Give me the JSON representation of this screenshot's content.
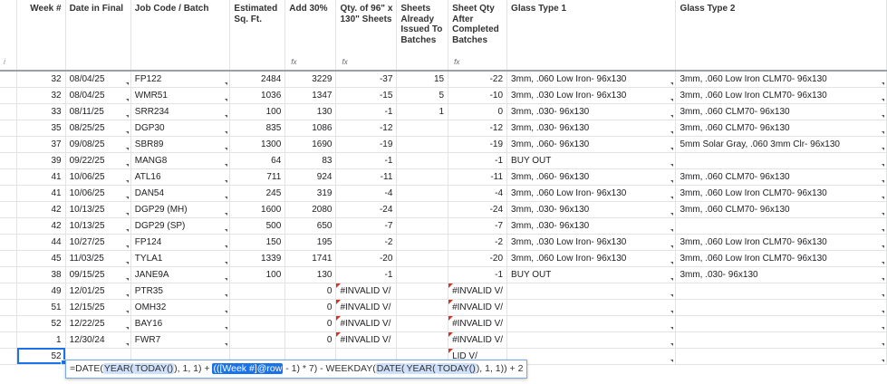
{
  "columns": [
    {
      "label": "",
      "info": "i"
    },
    {
      "label": "Week #"
    },
    {
      "label": "Date in Final"
    },
    {
      "label": "Job Code / Batch"
    },
    {
      "label": "Estimated Sq. Ft."
    },
    {
      "label": "Add 30%",
      "fx": "fx"
    },
    {
      "label": "Qty. of 96\" x 130\" Sheets",
      "fx": "fx"
    },
    {
      "label": "Sheets Already Issued To Batches"
    },
    {
      "label": "Sheet Qty After Completed Batches",
      "fx": "fx"
    },
    {
      "label": "Glass Type 1"
    },
    {
      "label": "Glass Type 2"
    }
  ],
  "rows": [
    {
      "week": "32",
      "date": "08/04/25",
      "job": "FP122",
      "sqft": "2484",
      "add": "3229",
      "qty": "-37",
      "issued": "15",
      "after": "-22",
      "g1": "3mm, .060 Low Iron- 96x130",
      "g2": "3mm, .060 Low Iron CLM70- 96x130"
    },
    {
      "week": "32",
      "date": "08/04/25",
      "job": "WMR51",
      "sqft": "1036",
      "add": "1347",
      "qty": "-15",
      "issued": "5",
      "after": "-10",
      "g1": "3mm, .030 Low Iron- 96x130",
      "g2": "3mm, .060 Low Iron CLM70- 96x130"
    },
    {
      "week": "33",
      "date": "08/11/25",
      "job": "SRR234",
      "sqft": "100",
      "add": "130",
      "qty": "-1",
      "issued": "1",
      "after": "0",
      "g1": "3mm, .030- 96x130",
      "g2": "3mm, .060 CLM70- 96x130"
    },
    {
      "week": "35",
      "date": "08/25/25",
      "job": "DGP30",
      "sqft": "835",
      "add": "1086",
      "qty": "-12",
      "issued": "",
      "after": "-12",
      "g1": "3mm, .030- 96x130",
      "g2": "3mm, .060 CLM70- 96x130"
    },
    {
      "week": "37",
      "date": "09/08/25",
      "job": "SBR89",
      "sqft": "1300",
      "add": "1690",
      "qty": "-19",
      "issued": "",
      "after": "-19",
      "g1": "3mm, .060- 96x130",
      "g2": "5mm Solar Gray, .060 3mm Clr- 96x130"
    },
    {
      "week": "39",
      "date": "09/22/25",
      "job": "MANG8",
      "sqft": "64",
      "add": "83",
      "qty": "-1",
      "issued": "",
      "after": "-1",
      "g1": "BUY OUT",
      "g2": ""
    },
    {
      "week": "41",
      "date": "10/06/25",
      "job": "ATL16",
      "sqft": "711",
      "add": "924",
      "qty": "-11",
      "issued": "",
      "after": "-11",
      "g1": "3mm, .060- 96x130",
      "g2": "3mm, .060 CLM70- 96x130"
    },
    {
      "week": "41",
      "date": "10/06/25",
      "job": "DAN54",
      "sqft": "245",
      "add": "319",
      "qty": "-4",
      "issued": "",
      "after": "-4",
      "g1": "3mm, .060 Low Iron- 96x130",
      "g2": "3mm, .060 Low Iron CLM70- 96x130"
    },
    {
      "week": "42",
      "date": "10/13/25",
      "job": "DGP29 (MH)",
      "sqft": "1600",
      "add": "2080",
      "qty": "-24",
      "issued": "",
      "after": "-24",
      "g1": "3mm, .030- 96x130",
      "g2": "3mm, .060 CLM70- 96x130"
    },
    {
      "week": "42",
      "date": "10/13/25",
      "job": "DGP29 (SP)",
      "sqft": "500",
      "add": "650",
      "qty": "-7",
      "issued": "",
      "after": "-7",
      "g1": "3mm, .030- 96x130",
      "g2": ""
    },
    {
      "week": "44",
      "date": "10/27/25",
      "job": "FP124",
      "sqft": "150",
      "add": "195",
      "qty": "-2",
      "issued": "",
      "after": "-2",
      "g1": "3mm, .030 Low Iron- 96x130",
      "g2": "3mm, .060 Low Iron CLM70- 96x130"
    },
    {
      "week": "45",
      "date": "11/03/25",
      "job": "TYLA1",
      "sqft": "1339",
      "add": "1741",
      "qty": "-20",
      "issued": "",
      "after": "-20",
      "g1": "3mm, .060 Low Iron- 96x130",
      "g2": "3mm, .060 Low Iron CLM70- 96x130"
    },
    {
      "week": "38",
      "date": "09/15/25",
      "job": "JANE9A",
      "sqft": "100",
      "add": "130",
      "qty": "-1",
      "issued": "",
      "after": "-1",
      "g1": "BUY OUT",
      "g2": "3mm, .030- 96x130"
    },
    {
      "week": "49",
      "date": "12/01/25",
      "job": "PTR35",
      "sqft": "",
      "add": "0",
      "qty": "#INVALID V/",
      "issued": "",
      "after": "#INVALID V/",
      "g1": "",
      "g2": ""
    },
    {
      "week": "51",
      "date": "12/15/25",
      "job": "OMH32",
      "sqft": "",
      "add": "0",
      "qty": "#INVALID V/",
      "issued": "",
      "after": "#INVALID V/",
      "g1": "",
      "g2": ""
    },
    {
      "week": "52",
      "date": "12/22/25",
      "job": "BAY16",
      "sqft": "",
      "add": "0",
      "qty": "#INVALID V/",
      "issued": "",
      "after": "#INVALID V/",
      "g1": "",
      "g2": ""
    },
    {
      "week": "1",
      "date": "12/30/24",
      "job": "FWR7",
      "sqft": "",
      "add": "0",
      "qty": "#INVALID V/",
      "issued": "",
      "after": "#INVALID V/",
      "g1": "",
      "g2": ""
    },
    {
      "week": "52",
      "date": "",
      "job": "",
      "sqft": "",
      "add": "",
      "qty": "",
      "issued": "",
      "after": "LID V/",
      "g1": "",
      "g2": ""
    }
  ],
  "formula": {
    "parts": [
      "=DATE(",
      "YEAR(",
      "TODAY()",
      "), 1, 1) + ",
      "(([Week #]@row",
      " - 1) * 7) - WEEKDAY(",
      "DATE(",
      "YEAR(",
      "TODAY()",
      "), 1, 1)",
      ") + 2"
    ]
  }
}
